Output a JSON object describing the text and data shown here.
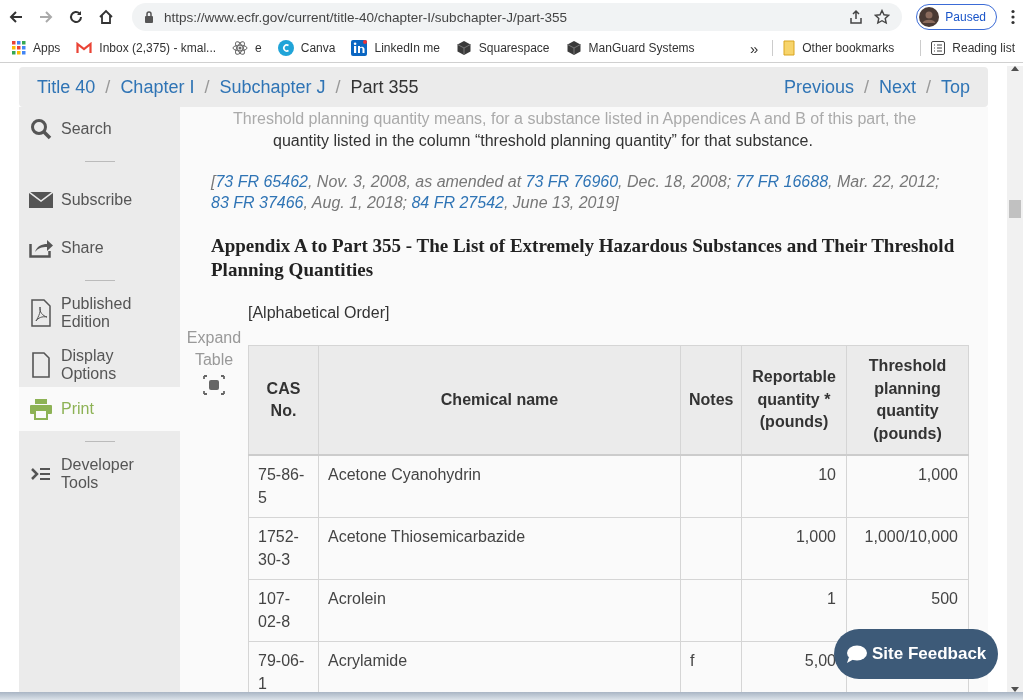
{
  "browser": {
    "url": "https://www.ecfr.gov/current/title-40/chapter-I/subchapter-J/part-355",
    "profile": "Paused",
    "bookmarks": [
      {
        "kind": "apps",
        "label": "Apps"
      },
      {
        "kind": "mail",
        "label": "Inbox (2,375) - kmal..."
      },
      {
        "kind": "atom",
        "label": "e"
      },
      {
        "kind": "circle",
        "label": "Canva"
      },
      {
        "kind": "square",
        "label": "LinkedIn me"
      },
      {
        "kind": "cube",
        "label": "Squarespace"
      },
      {
        "kind": "cube",
        "label": "ManGuard Systems"
      }
    ],
    "overflow": "»",
    "other_bookmarks": "Other bookmarks",
    "reading_list": "Reading list"
  },
  "breadcrumb": {
    "separator": "/",
    "items": [
      "Title 40",
      "Chapter I",
      "Subchapter J"
    ],
    "current": "Part 355",
    "nav": [
      "Previous",
      "Next",
      "Top"
    ]
  },
  "sidebar": {
    "items": [
      {
        "label": "Search",
        "selected": false,
        "divider_after": true
      },
      {
        "label": "Subscribe",
        "selected": false,
        "divider_after": false
      },
      {
        "label": "Share",
        "selected": false,
        "divider_after": true
      },
      {
        "label": "Published Edition",
        "selected": false,
        "divider_after": false
      },
      {
        "label": "Display Options",
        "selected": false,
        "divider_after": false
      },
      {
        "label": "Print",
        "selected": true,
        "divider_after": true
      },
      {
        "label": "Developer Tools",
        "selected": false,
        "divider_after": false
      }
    ]
  },
  "content": {
    "faded_line": "Threshold planning quantity means, for a substance listed in Appendices A and B of this part, the",
    "definition_line": "quantity listed in the column “threshold planning quantity” for that substance.",
    "citation": [
      {
        "text": "[",
        "link": false
      },
      {
        "text": "73 FR 65462",
        "link": true
      },
      {
        "text": ", Nov. 3, 2008, as amended at ",
        "link": false
      },
      {
        "text": "73 FR 76960",
        "link": true
      },
      {
        "text": ", Dec. 18, 2008; ",
        "link": false
      },
      {
        "text": "77 FR 16688",
        "link": true
      },
      {
        "text": ", Mar. 22, 2012; ",
        "link": false
      },
      {
        "text": "83 FR 37466",
        "link": true
      },
      {
        "text": ", Aug. 1, 2018; ",
        "link": false
      },
      {
        "text": "84 FR 27542",
        "link": true
      },
      {
        "text": ", June 13, 2019]",
        "link": false
      }
    ],
    "heading": "Appendix A to Part 355 - The List of Extremely Hazardous Substances and Their Threshold Planning Quantities",
    "order_note": "[Alphabetical Order]",
    "expand_table": "Expand Table",
    "table": {
      "columns": [
        "CAS No.",
        "Chemical name",
        "Notes",
        "Reportable quantity * (pounds)",
        "Threshold planning quantity (pounds)"
      ],
      "rows": [
        [
          "75-86-5",
          "Acetone Cyanohydrin",
          "",
          "10",
          "1,000"
        ],
        [
          "1752-30-3",
          "Acetone Thiosemicarbazide",
          "",
          "1,000",
          "1,000/10,000"
        ],
        [
          "107-02-8",
          "Acrolein",
          "",
          "1",
          "500"
        ],
        [
          "79-06-1",
          "Acrylamide",
          "f",
          "5,00",
          ""
        ]
      ]
    }
  },
  "feedback_button": "Site Feedback"
}
